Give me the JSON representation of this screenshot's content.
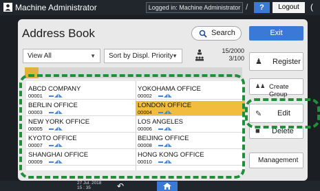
{
  "topbar": {
    "title": "Machine Administrator",
    "login_status": "Logged in: Machine Administrator",
    "help": "?",
    "logout": "Logout",
    "slash": "/",
    "extra_glyph": "("
  },
  "header": {
    "title": "Address Book",
    "search": "Search",
    "exit": "Exit"
  },
  "filters": {
    "view": "View All",
    "sort": "Sort by Displ. Priority"
  },
  "counter": {
    "total": "15/2000",
    "page": "3/100"
  },
  "entries": [
    {
      "name": "ABCD COMPANY",
      "num": "00001",
      "icons": "▬◢◣"
    },
    {
      "name": "YOKOHAMA OFFICE",
      "num": "00002",
      "icons": "▬◢◣"
    },
    {
      "name": "BERLIN OFFICE",
      "num": "00003",
      "icons": "▬◢◣"
    },
    {
      "name": "LONDON OFFICE",
      "num": "00004",
      "icons": "▬◢◣"
    },
    {
      "name": "NEW YORK OFFICE",
      "num": "00005",
      "icons": "▬◢◣"
    },
    {
      "name": "LOS ANGELES",
      "num": "00006",
      "icons": "▬◢◣"
    },
    {
      "name": "KYOTO OFFICE",
      "num": "00007",
      "icons": "▬◢◣"
    },
    {
      "name": "BEIJING OFFICE",
      "num": "00008",
      "icons": "▬◢◣"
    },
    {
      "name": "SHANGHAI OFFICE",
      "num": "00009",
      "icons": "▬◢◣"
    },
    {
      "name": "HONG KONG OFFICE",
      "num": "00010",
      "icons": "▬◢◣"
    }
  ],
  "side": {
    "register": "Register",
    "create_group": "Create Group",
    "edit": "Edit",
    "delete": "Delete",
    "management": "Management"
  },
  "footer": {
    "date": "27 Jul. 2018",
    "time": "15 : 35"
  },
  "colors": {
    "accent": "#3b79d6",
    "selected_row": "#f2bd3d",
    "annotation": "#1f8f3a"
  }
}
